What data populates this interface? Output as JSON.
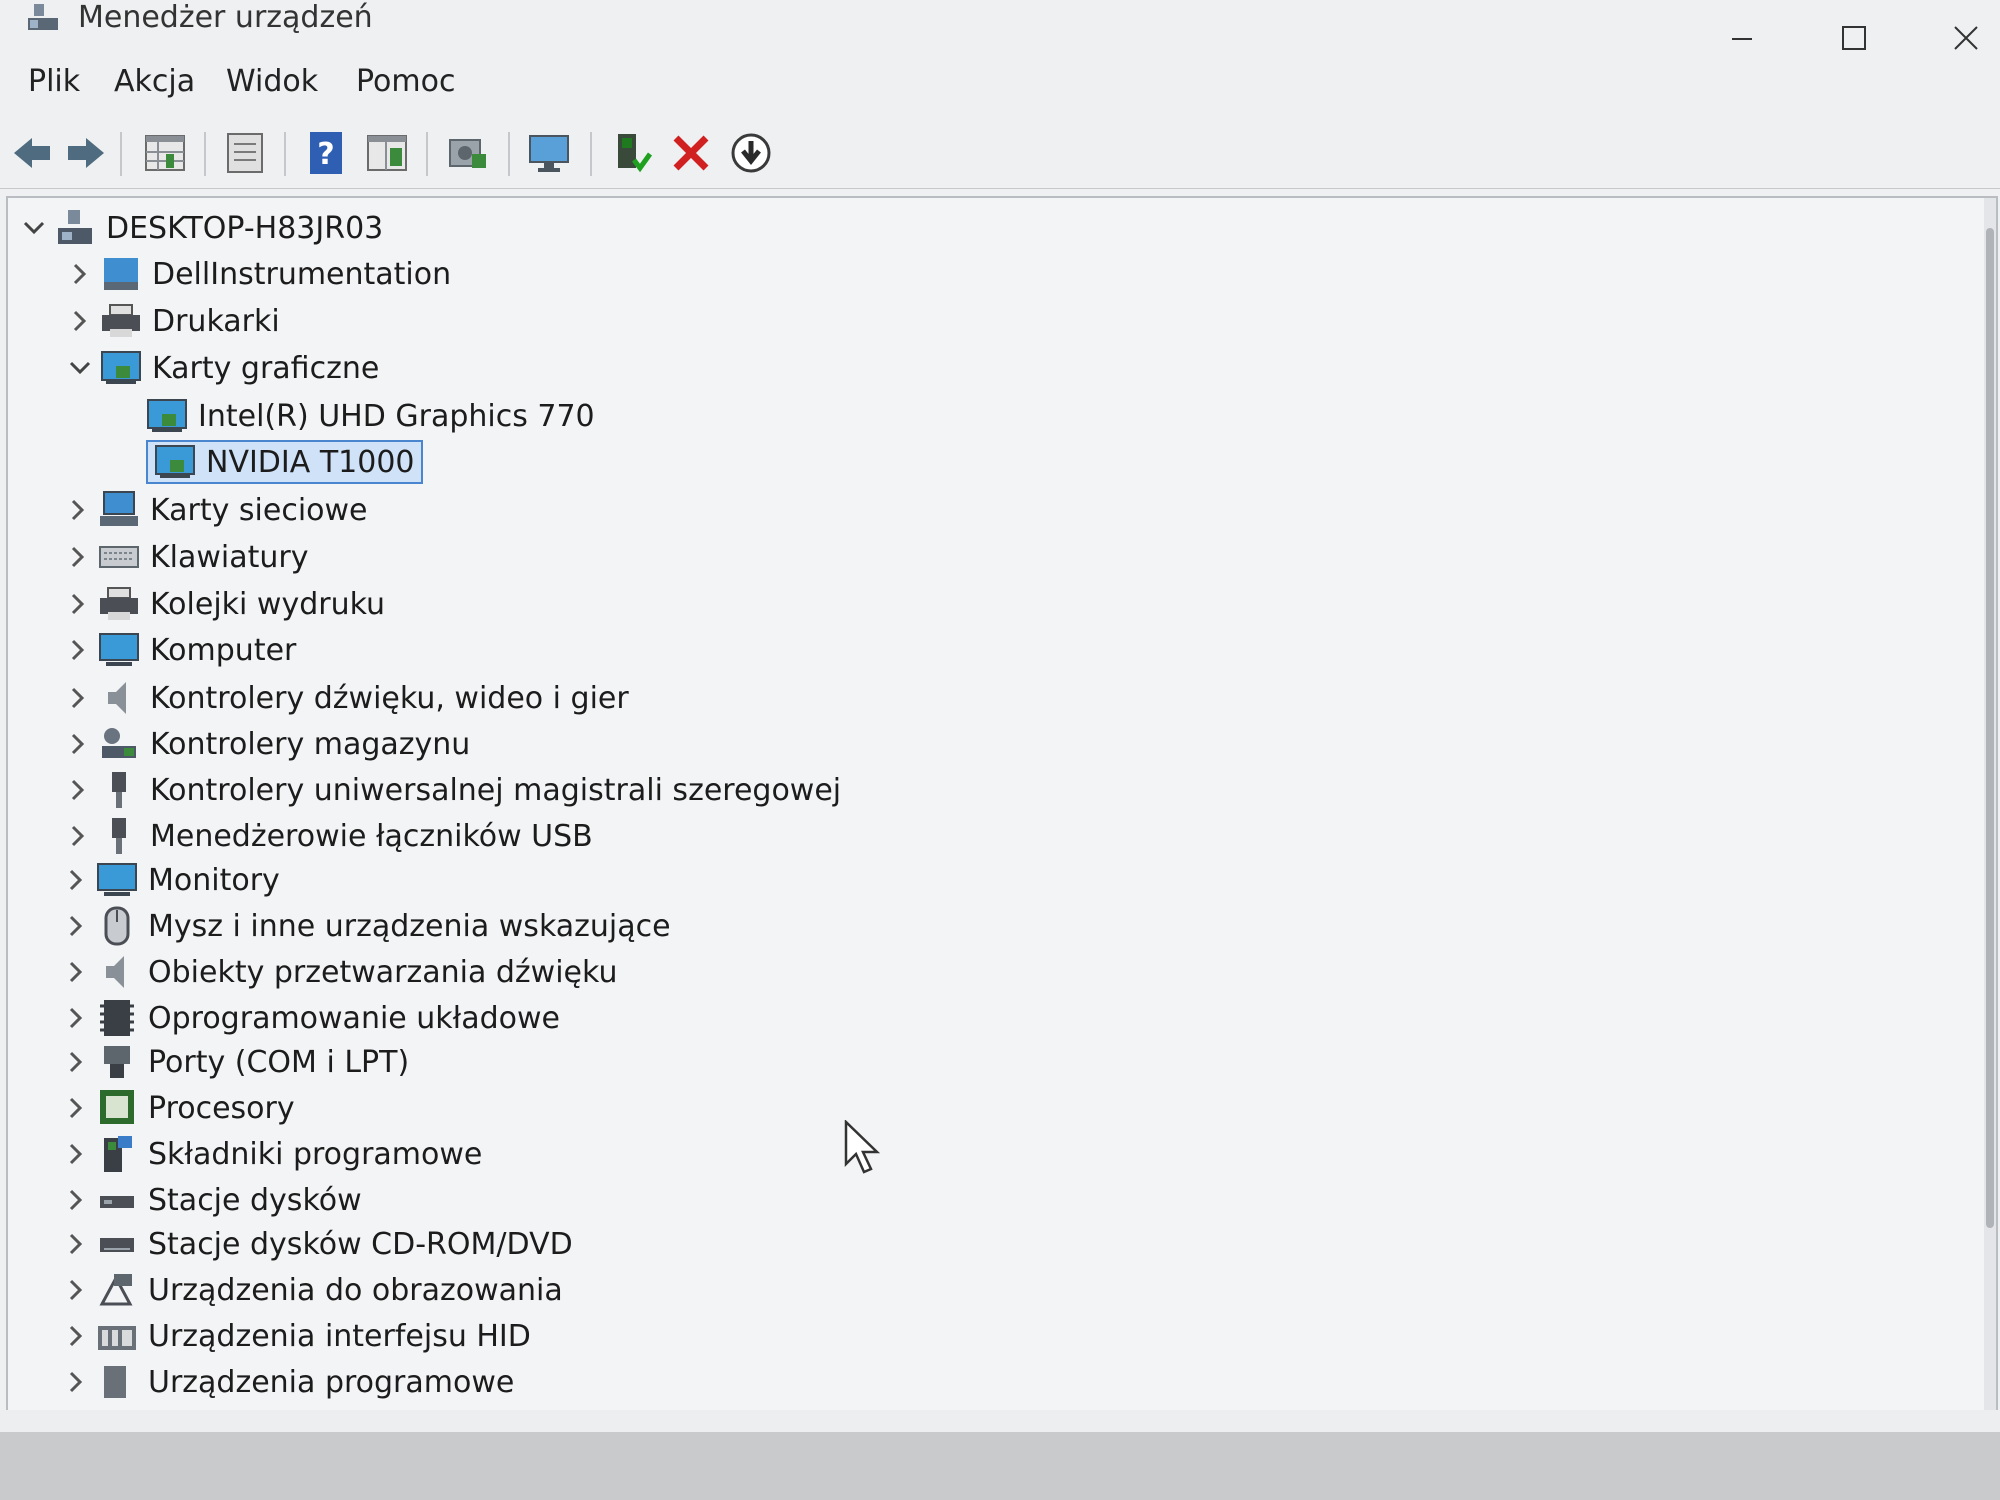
{
  "window": {
    "title": "Menedżer urządzeń"
  },
  "menu": [
    "Plik",
    "Akcja",
    "Widok",
    "Pomoc"
  ],
  "toolbar": [
    "back-icon",
    "forward-icon",
    "properties-grid-icon",
    "document-icon",
    "help-icon",
    "view-panel-icon",
    "scan-hardware-icon",
    "monitor-icon",
    "enable-device-icon",
    "uninstall-x-icon",
    "update-driver-icon"
  ],
  "colors": {
    "selection_border": "#4a86d0",
    "selection_bg": "#cfe2f7",
    "uninstall_red": "#d02020"
  },
  "tree": {
    "root": "DESKTOP-H83JR03",
    "items": [
      {
        "label": "DellInstrumentation",
        "icon": "dell-instrumentation-icon",
        "state": "collapsed"
      },
      {
        "label": "Drukarki",
        "icon": "printer-icon",
        "state": "collapsed"
      },
      {
        "label": "Karty graficzne",
        "icon": "display-adapter-icon",
        "state": "expanded",
        "children": [
          {
            "label": "Intel(R) UHD Graphics 770",
            "icon": "display-adapter-icon"
          },
          {
            "label": "NVIDIA T1000",
            "icon": "display-adapter-icon",
            "selected": true
          }
        ]
      },
      {
        "label": "Karty sieciowe",
        "icon": "network-icon",
        "state": "collapsed"
      },
      {
        "label": "Klawiatury",
        "icon": "keyboard-icon",
        "state": "collapsed"
      },
      {
        "label": "Kolejki wydruku",
        "icon": "printer-icon",
        "state": "collapsed"
      },
      {
        "label": "Komputer",
        "icon": "computer-icon",
        "state": "collapsed"
      },
      {
        "label": "Kontrolery dźwięku, wideo i gier",
        "icon": "speaker-icon",
        "state": "collapsed"
      },
      {
        "label": "Kontrolery magazynu",
        "icon": "storage-controller-icon",
        "state": "collapsed"
      },
      {
        "label": "Kontrolery uniwersalnej magistrali szeregowej",
        "icon": "usb-icon",
        "state": "collapsed"
      },
      {
        "label": "Menedżerowie łączników USB",
        "icon": "usb-icon",
        "state": "collapsed"
      },
      {
        "label": "Monitory",
        "icon": "monitor-icon",
        "state": "collapsed"
      },
      {
        "label": "Mysz i inne urządzenia wskazujące",
        "icon": "mouse-icon",
        "state": "collapsed"
      },
      {
        "label": "Obiekty przetwarzania dźwięku",
        "icon": "speaker-icon",
        "state": "collapsed"
      },
      {
        "label": "Oprogramowanie układowe",
        "icon": "firmware-icon",
        "state": "collapsed"
      },
      {
        "label": "Porty (COM i LPT)",
        "icon": "port-icon",
        "state": "collapsed"
      },
      {
        "label": "Procesory",
        "icon": "processor-icon",
        "state": "collapsed"
      },
      {
        "label": "Składniki programowe",
        "icon": "software-component-icon",
        "state": "collapsed"
      },
      {
        "label": "Stacje dysków",
        "icon": "disk-drive-icon",
        "state": "collapsed"
      },
      {
        "label": "Stacje dysków CD-ROM/DVD",
        "icon": "dvd-drive-icon",
        "state": "collapsed"
      },
      {
        "label": "Urządzenia do obrazowania",
        "icon": "camera-icon",
        "state": "collapsed"
      },
      {
        "label": "Urządzenia interfejsu HID",
        "icon": "hid-icon",
        "state": "collapsed"
      },
      {
        "label": "Urządzenia programowe",
        "icon": "software-device-icon",
        "state": "collapsed"
      }
    ]
  }
}
